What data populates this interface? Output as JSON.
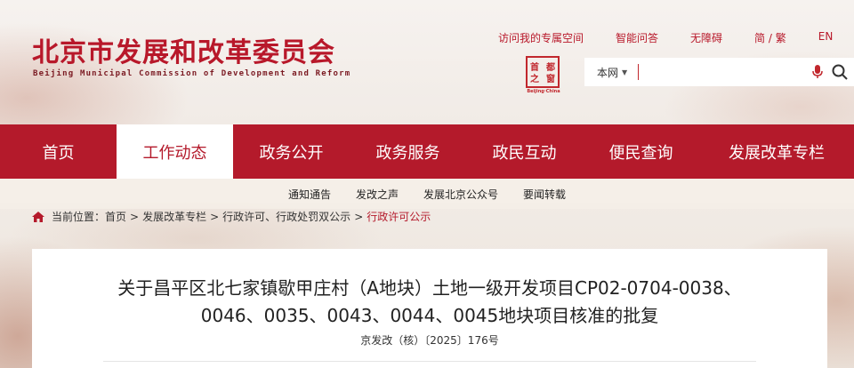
{
  "header": {
    "title": "北京市发展和改革委员会",
    "subtitle": "Beijing Municipal Commission of Development and Reform",
    "top_links": [
      "访问我的专属空间",
      "智能问答",
      "无障碍",
      "简 / 繁",
      "EN"
    ],
    "seal": {
      "chars": [
        "首",
        "都",
        "窗",
        "之"
      ],
      "caption": "Beijing·China"
    }
  },
  "search": {
    "scope_label": "本网",
    "value": "",
    "icons": [
      "mic-icon",
      "search-icon"
    ]
  },
  "nav": {
    "items": [
      "首页",
      "工作动态",
      "政务公开",
      "政务服务",
      "政民互动",
      "便民查询",
      "发展改革专栏"
    ],
    "active": "工作动态"
  },
  "subnav": {
    "items": [
      "通知通告",
      "发改之声",
      "发展北京公众号",
      "要闻转载"
    ]
  },
  "breadcrumb": {
    "label": "当前位置：",
    "items": [
      "首页",
      "发展改革专栏",
      "行政许可、行政处罚双公示",
      "行政许可公示"
    ],
    "separator": ">"
  },
  "article": {
    "title_line1": "关于昌平区北七家镇歇甲庄村（A地块）土地一级开发项目CP02-0704-0038、",
    "title_line2": "0046、0035、0043、0044、0045地块项目核准的批复",
    "doc_number": "京发改（核）〔2025〕176号"
  },
  "colors": {
    "brand_red": "#b41a2b",
    "title_red": "#b8182a"
  }
}
